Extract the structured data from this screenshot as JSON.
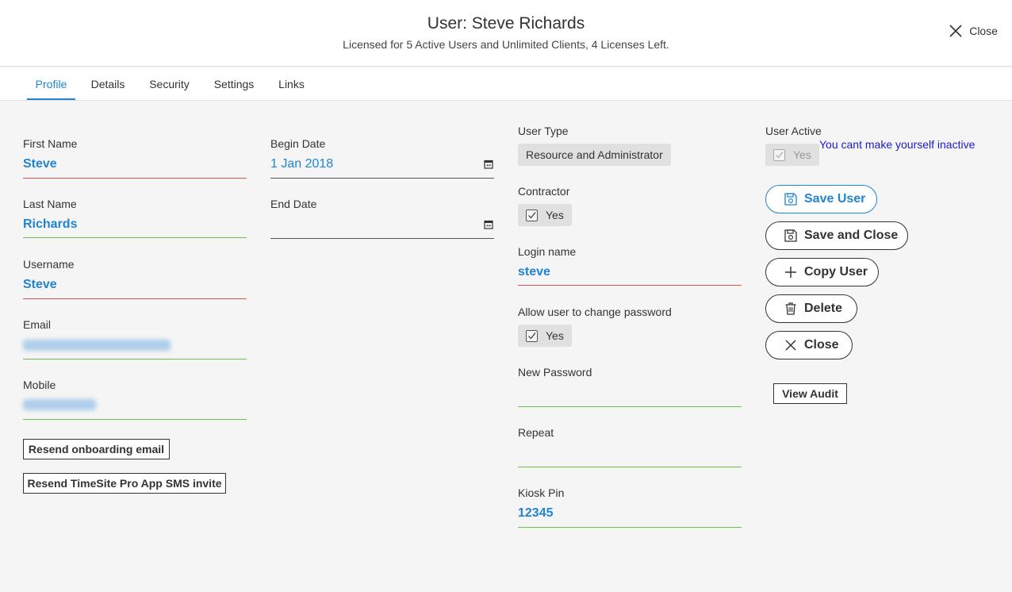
{
  "header": {
    "title": "User: Steve Richards",
    "subtitle": "Licensed for 5 Active Users and Unlimited Clients, 4 Licenses Left.",
    "close_label": "Close"
  },
  "tabs": [
    {
      "label": "Profile",
      "active": true
    },
    {
      "label": "Details",
      "active": false
    },
    {
      "label": "Security",
      "active": false
    },
    {
      "label": "Settings",
      "active": false
    },
    {
      "label": "Links",
      "active": false
    }
  ],
  "profile": {
    "first_name": {
      "label": "First Name",
      "value": "Steve"
    },
    "last_name": {
      "label": "Last Name",
      "value": "Richards"
    },
    "username": {
      "label": "Username",
      "value": "Steve"
    },
    "email": {
      "label": "Email"
    },
    "mobile": {
      "label": "Mobile"
    },
    "resend_onboarding_label": "Resend onboarding email",
    "resend_sms_label": "Resend TimeSite Pro App SMS invite"
  },
  "dates": {
    "begin": {
      "label": "Begin Date",
      "value": "1 Jan 2018"
    },
    "end": {
      "label": "End Date",
      "value": ""
    }
  },
  "account": {
    "user_type": {
      "label": "User Type",
      "value": "Resource and Administrator"
    },
    "contractor": {
      "label": "Contractor",
      "value": "Yes",
      "checked": true
    },
    "login_name": {
      "label": "Login name",
      "value": "steve"
    },
    "allow_change_password": {
      "label": "Allow user to change password",
      "value": "Yes",
      "checked": true
    },
    "new_password": {
      "label": "New Password",
      "value": ""
    },
    "repeat": {
      "label": "Repeat",
      "value": ""
    },
    "kiosk_pin": {
      "label": "Kiosk Pin",
      "value": "12345"
    }
  },
  "status": {
    "user_active": {
      "label": "User Active",
      "value": "Yes",
      "checked": true,
      "disabled": true
    },
    "note": "You cant make yourself inactive"
  },
  "actions": {
    "save_user": "Save User",
    "save_and_close": "Save and Close",
    "copy_user": "Copy User",
    "delete": "Delete",
    "close": "Close",
    "view_audit": "View Audit"
  },
  "colors": {
    "accent": "#1f84d3",
    "error_underline": "#d9534f",
    "valid_underline": "#6cc04a",
    "note_text": "#1a1acc"
  }
}
